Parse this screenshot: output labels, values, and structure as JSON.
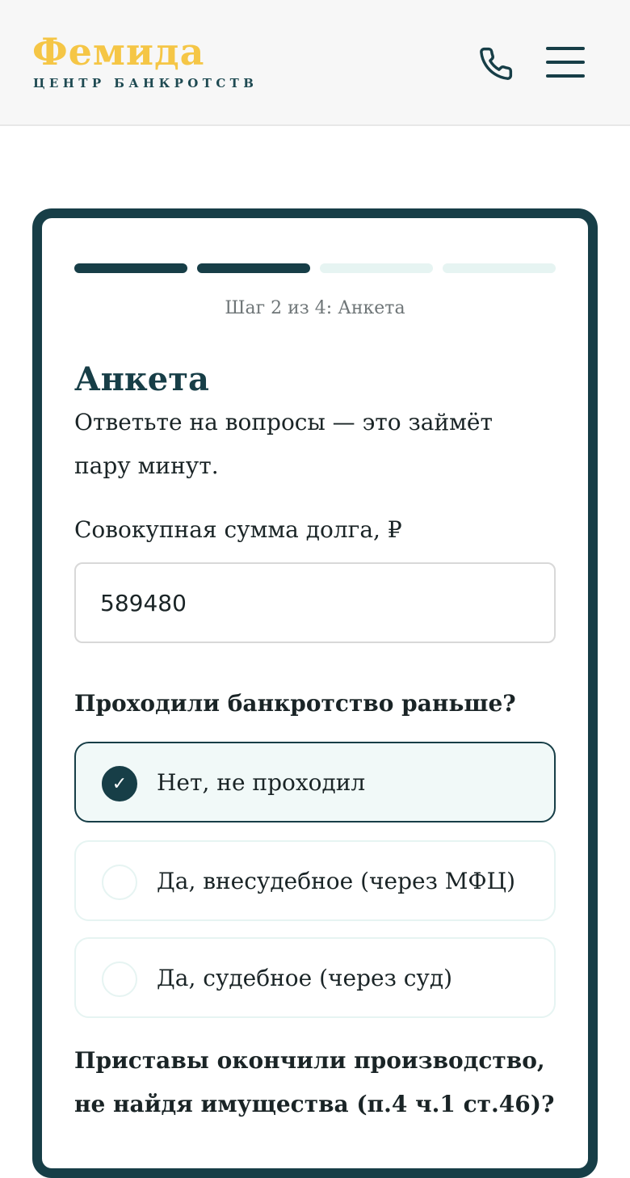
{
  "header": {
    "logo_title": "Фемида",
    "logo_subtitle": "ЦЕНТР БАНКРОТСТВ",
    "phone_icon": "phone-icon",
    "menu_icon": "hamburger-menu-icon"
  },
  "colors": {
    "brand_dark": "#173e47",
    "brand_yellow": "#f5c646",
    "progress_inactive": "#e6f4f2"
  },
  "form": {
    "progress": {
      "current_step": 2,
      "total_steps": 4
    },
    "step_label": "Шаг 2 из 4: Анкета",
    "title": "Анкета",
    "subtitle": "Ответьте на вопросы — это займёт пару минут.",
    "debt_label": "Совокупная сумма долга, ₽",
    "debt_value": "589480",
    "question1": "Проходили банкротство раньше?",
    "options": [
      {
        "label": "Нет, не проходил",
        "selected": true
      },
      {
        "label": "Да, внесудебное (через МФЦ)",
        "selected": false
      },
      {
        "label": "Да, судебное (через суд)",
        "selected": false
      }
    ],
    "question2": "Приставы окончили производство, не найдя имущества (п.4 ч.1 ст.46)?"
  }
}
